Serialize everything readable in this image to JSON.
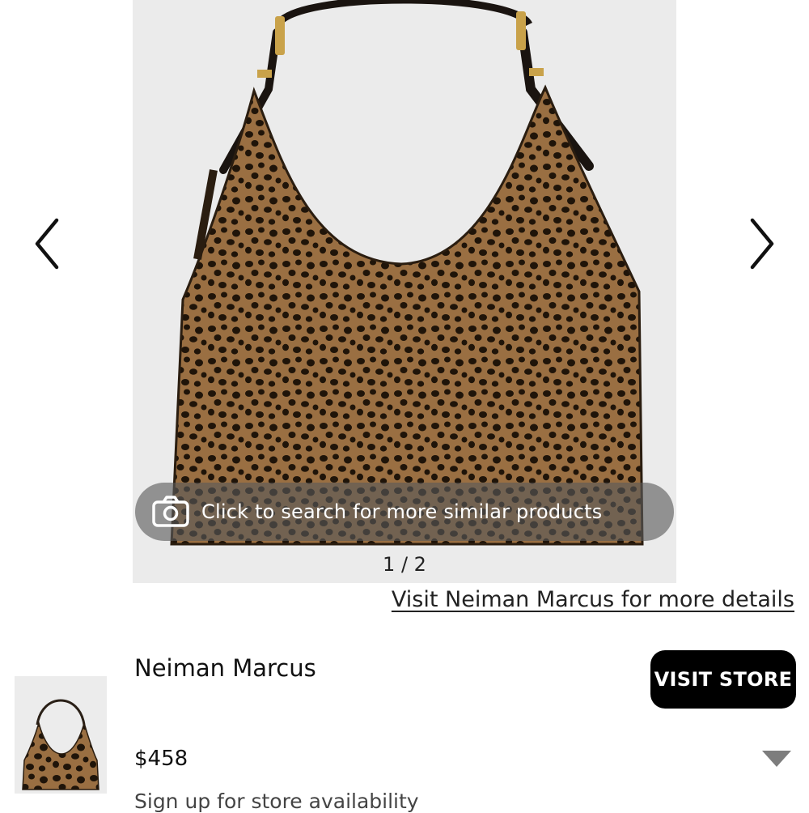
{
  "gallery": {
    "visual_search_label": "Click to search for more similar products",
    "counter": "1 / 2",
    "prev_icon": "chevron-left-icon",
    "next_icon": "chevron-right-icon",
    "camera_icon": "camera-icon"
  },
  "details_link": "Visit Neiman Marcus for more details",
  "listing": {
    "store_name": "Neiman Marcus",
    "visit_store_label": "VISIT STORE",
    "price": "$458",
    "availability": "Sign up for store availability",
    "expand_icon": "triangle-down-icon"
  },
  "colors": {
    "gallery_bg": "#ebebeb",
    "button_bg": "#000000",
    "leopard_base": "#9a6f42",
    "spot": "#1f1409"
  }
}
